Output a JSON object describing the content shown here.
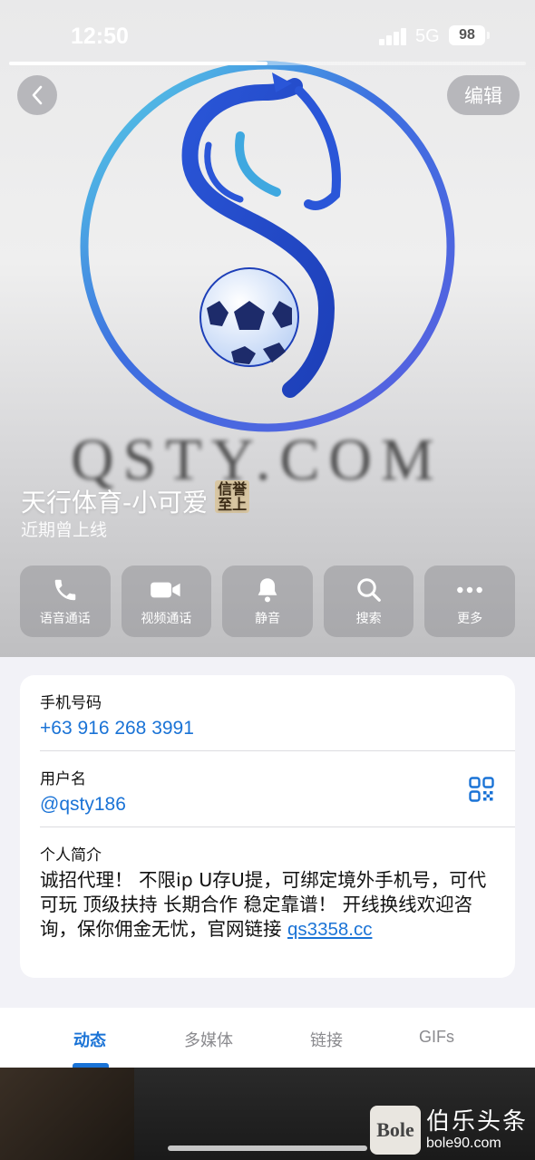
{
  "status_bar": {
    "time": "12:50",
    "network": "5G",
    "battery": "98",
    "story_progress": 0.5
  },
  "header": {
    "back_icon": "chevron-left-icon",
    "edit_label": "编辑",
    "avatar_logo_text": "QSTY.COM",
    "name": "天行体育-小可爱",
    "name_badge": "信誉至上",
    "status": "近期曾上线",
    "colors": {
      "logo_blue": "#2f6be0",
      "logo_cyan": "#4fd0e8"
    }
  },
  "actions": [
    {
      "icon": "phone-icon",
      "label": "语音通话"
    },
    {
      "icon": "video-camera-icon",
      "label": "视频通话"
    },
    {
      "icon": "bell-icon",
      "label": "静音"
    },
    {
      "icon": "search-icon",
      "label": "搜索"
    },
    {
      "icon": "more-dots-icon",
      "label": "更多"
    }
  ],
  "info": {
    "phone_label": "手机号码",
    "phone_value": "+63 916 268 3991",
    "username_label": "用户名",
    "username_value": "@qsty186",
    "qr_icon": "qr-code-icon",
    "bio_label": "个人简介",
    "bio_text": "诚招代理！ 不限ip U存U提，可绑定境外手机号，可代可玩 顶级扶持 长期合作 稳定靠谱！ 开线换线欢迎咨询，保你佣金无忧，官网链接 ",
    "bio_link": "qs3358.cc"
  },
  "tabs": [
    {
      "label": "动态",
      "active": true
    },
    {
      "label": "多媒体",
      "active": false
    },
    {
      "label": "链接",
      "active": false
    },
    {
      "label": "GIFs",
      "active": false
    }
  ],
  "watermark": {
    "logo_text": "Bole",
    "title": "伯乐头条",
    "site": "bole90.com"
  },
  "accent_color": "#1a73d6"
}
